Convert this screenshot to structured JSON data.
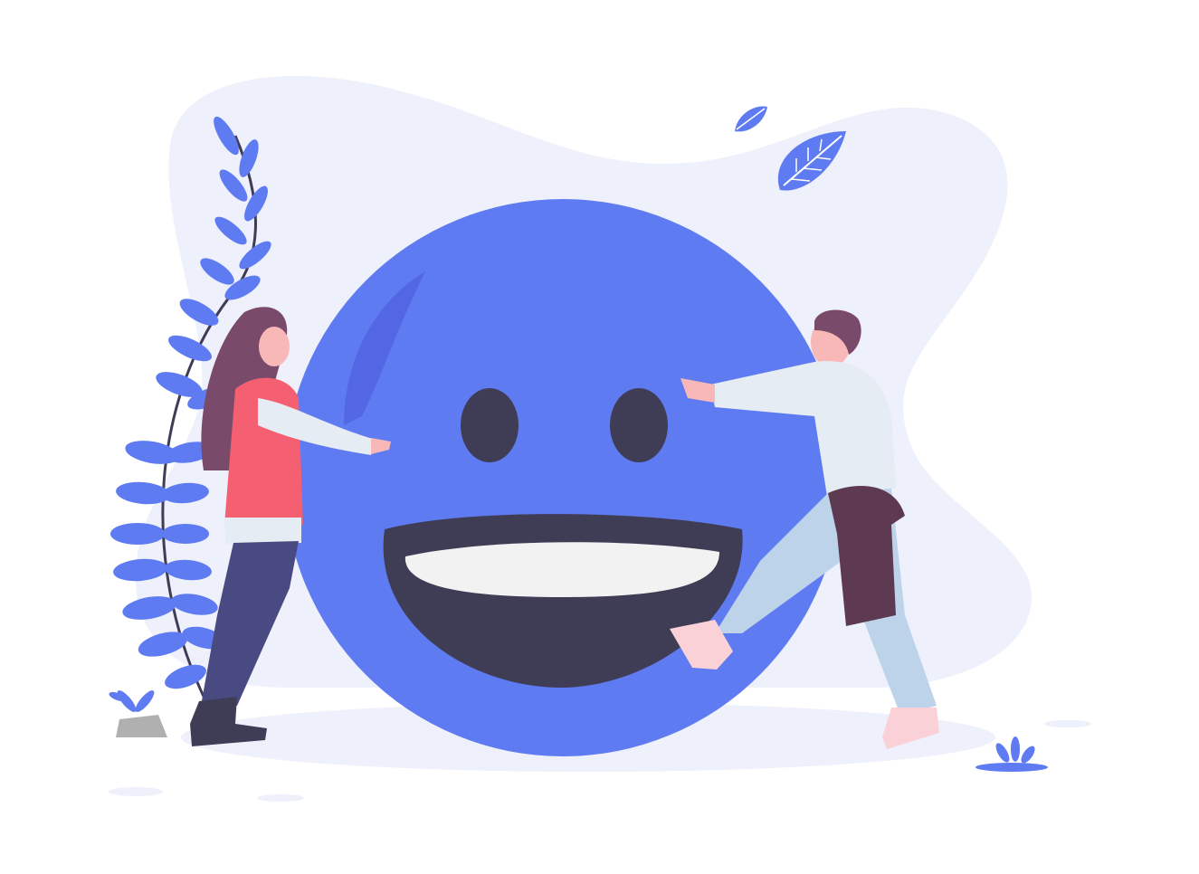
{
  "illustration": {
    "subject": "two-people-hugging-smiley-face",
    "palette": {
      "accent": "#5f7bf1",
      "accent_dark": "#4f5fe0",
      "backdrop": "#eef0fb",
      "face_features": "#3f3d56",
      "teeth": "#f2f2f2",
      "woman_top": "#f55f72",
      "woman_jeans": "#4a4a82",
      "woman_hair": "#7a4a6a",
      "man_shirt": "#e6ecf3",
      "man_jeans": "#bcd3ea",
      "man_sweater": "#5e3a52",
      "skin": "#f8b8b8",
      "shadow": "#eef0fb",
      "rock": "#b0b0b0",
      "stem": "#3f3d56"
    },
    "icons": [
      "smiley-face-icon",
      "leaf-icon",
      "plant-icon"
    ]
  }
}
